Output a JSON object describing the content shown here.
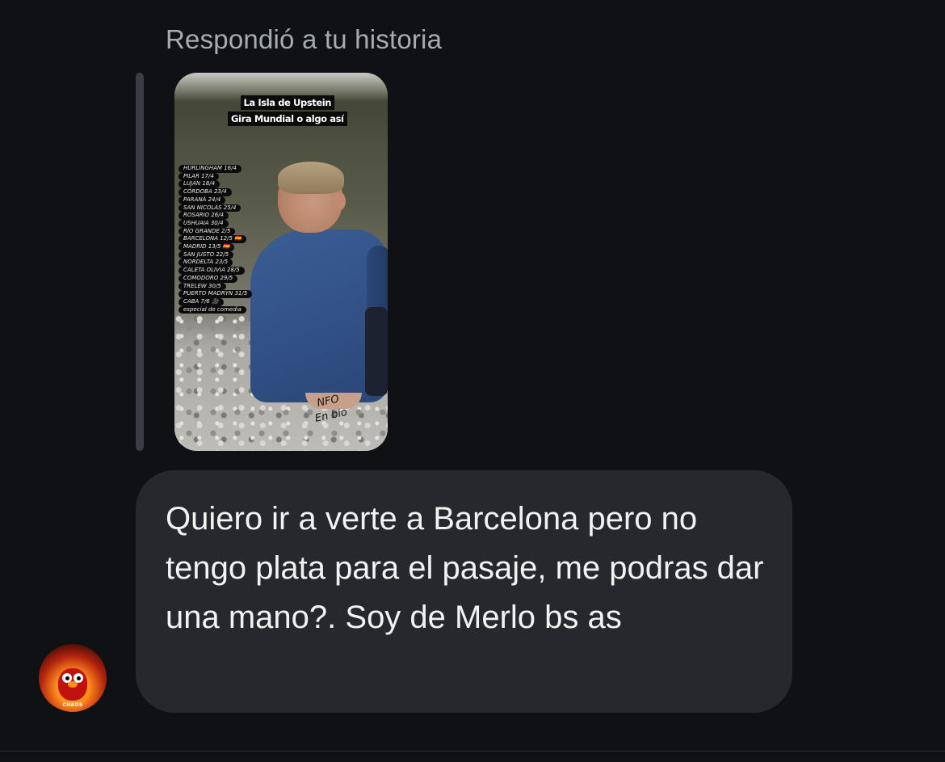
{
  "reply_context": {
    "label": "Respondió a tu historia"
  },
  "story": {
    "title_lines": [
      "La Isla de Upstein",
      "Gira Mundial o algo así"
    ],
    "tour_dates": [
      "HURLINGHAM 16/4",
      "PILAR 17/4",
      "LUJÁN 18/4",
      "CÓRDOBA 23/4",
      "PARANÁ 24/4",
      "SAN NICOLÁS 25/4",
      "ROSARIO 26/4",
      "USHUAIA 30/4",
      "RÍO GRANDE 2/5",
      "BARCELONA 12/5 🇪🇸",
      "MADRID 13/5 🇪🇸",
      "SAN JUSTO 22/5",
      "NORDELTA 23/5",
      "CALETA OLIVIA 28/5",
      "COMODORO 29/5",
      "TRELEW 30/5",
      "PUERTO MADRYN 31/5",
      "CABA 7/6 🎥",
      "especial de comedia"
    ],
    "caption_lines": [
      "NFO",
      "En bio"
    ]
  },
  "message": {
    "text": "Quiero ir a verte a Barcelona pero no tengo plata para el pasaje, me podras dar una mano?. Soy de Merlo bs as"
  },
  "avatar": {
    "label": "CHAOS"
  }
}
